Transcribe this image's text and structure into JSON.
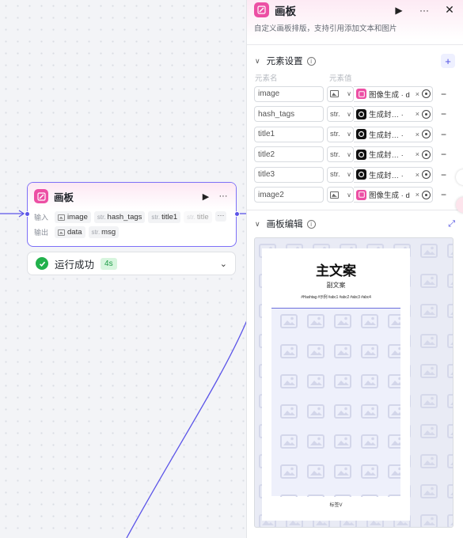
{
  "node": {
    "title": "画板",
    "input_label": "输入",
    "output_label": "输出",
    "inputs": [
      {
        "type": "",
        "name": "image",
        "icon": "image-icon"
      },
      {
        "type": "str.",
        "name": "hash_tags"
      },
      {
        "type": "str.",
        "name": "title1"
      },
      {
        "type": "str.",
        "name": "title"
      }
    ],
    "outputs": [
      {
        "type": "",
        "name": "data",
        "icon": "image-icon"
      },
      {
        "type": "str.",
        "name": "msg"
      }
    ],
    "more": "···"
  },
  "status": {
    "text": "运行成功",
    "time": "4s",
    "color": "#22b14c"
  },
  "panel": {
    "title": "画板",
    "description": "自定义画板排版，支持引用添加文本和图片",
    "elements_section": "元素设置",
    "col_name": "元素名",
    "col_value": "元素值",
    "elements": [
      {
        "name": "image",
        "type": "",
        "type_icon": "image-icon",
        "value": "图像生成 · d",
        "value_icon": "canvas-app-icon"
      },
      {
        "name": "hash_tags",
        "type": "str.",
        "value": "生成封… · ",
        "value_icon": "llm-icon"
      },
      {
        "name": "title1",
        "type": "str.",
        "value": "生成封… · ",
        "value_icon": "llm-icon"
      },
      {
        "name": "title2",
        "type": "str.",
        "value": "生成封… · ",
        "value_icon": "llm-icon"
      },
      {
        "name": "title3",
        "type": "str.",
        "value": "生成封… · ",
        "value_icon": "llm-icon"
      },
      {
        "name": "image2",
        "type": "",
        "type_icon": "image-icon",
        "value": "图像生成 · d",
        "value_icon": "canvas-app-icon"
      }
    ],
    "editor_section": "画板编辑",
    "preview": {
      "main_title": "主文案",
      "sub_title": "副文案",
      "tags_line": "#Hashtag #示例 #abc1 #abc2 #abc3 #abc4",
      "footer": "标签V"
    }
  },
  "colors": {
    "accent": "#5b54e8",
    "brand_pink": "#ec4fa4",
    "success": "#22b14c"
  }
}
